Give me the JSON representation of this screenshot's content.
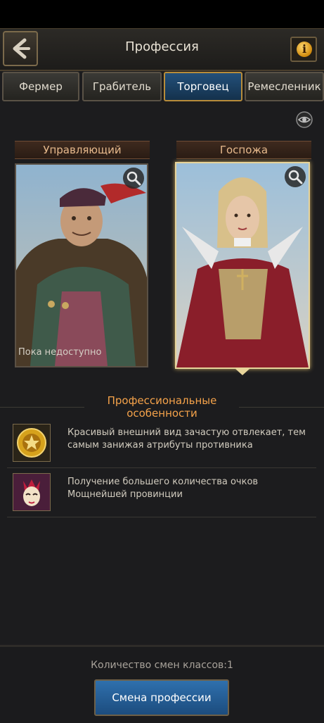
{
  "header": {
    "title": "Профессия",
    "info_symbol": "i"
  },
  "tabs": [
    {
      "label": "Фермер",
      "active": false
    },
    {
      "label": "Грабитель",
      "active": false
    },
    {
      "label": "Торговец",
      "active": true
    },
    {
      "label": "Ремесленник",
      "active": false
    }
  ],
  "cards": [
    {
      "label": "Управляющий",
      "status": "Пока недоступно",
      "selected": false
    },
    {
      "label": "Госпожа",
      "status": "",
      "selected": true
    }
  ],
  "features": {
    "title_line1": "Профессиональные",
    "title_line2": "особенности",
    "items": [
      {
        "icon": "crest-icon",
        "text": "Красивый внешний вид зачастую отвлекает, тем самым занижая атрибуты противника"
      },
      {
        "icon": "carnival-mask-icon",
        "text": "Получение большего количества очков Мощнейшей провинции"
      }
    ]
  },
  "footer": {
    "count_text": "Количество смен классов:1",
    "button_label": "Смена профессии"
  },
  "colors": {
    "accent_gold": "#b78c3a",
    "active_tab": "#23507a",
    "feature_title": "#f4a24a",
    "button_blue": "#2f70ad"
  }
}
